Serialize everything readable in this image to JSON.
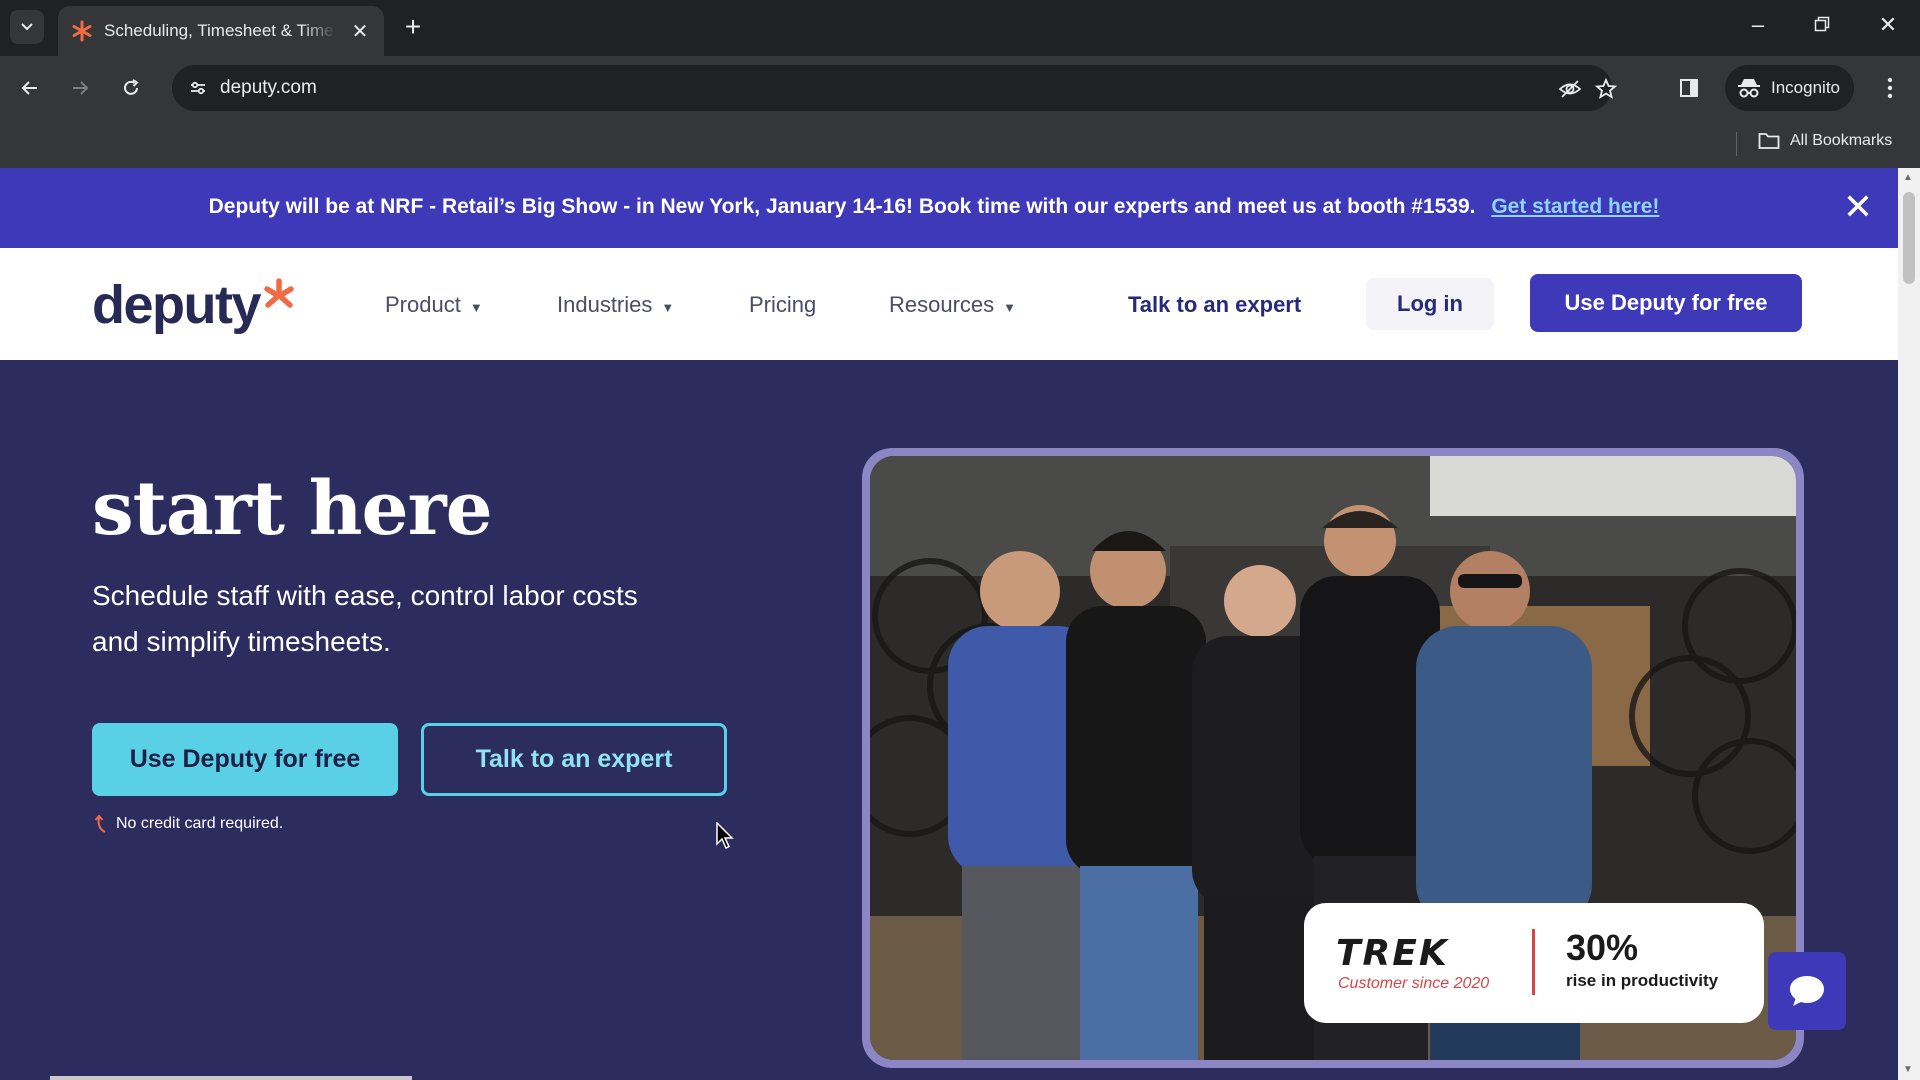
{
  "browser": {
    "tab_title": "Scheduling, Timesheet & Time Clock",
    "url": "deputy.com",
    "incognito_label": "Incognito",
    "bookmarks_label": "All Bookmarks",
    "new_tab": "+",
    "close_tab": "✕"
  },
  "banner": {
    "text": "Deputy will be at NRF - Retail’s Big Show - in New York, January 14-16! Book time with our experts and meet us at booth #1539.",
    "link": "Get started here!",
    "close": "✕"
  },
  "header": {
    "logo": "deputy",
    "nav": [
      {
        "label": "Product"
      },
      {
        "label": "Industries"
      },
      {
        "label": "Pricing"
      },
      {
        "label": "Resources"
      }
    ],
    "talk": "Talk to an expert",
    "login": "Log in",
    "cta": "Use Deputy for free"
  },
  "hero": {
    "title": "start here",
    "subtitle": "Schedule staff with ease, control labor costs and simplify timesheets.",
    "cta": "Use Deputy for free",
    "talk": "Talk to an expert",
    "no_card": "No credit card required."
  },
  "stat": {
    "brand": "TREK",
    "since": "Customer since 2020",
    "value": "30%",
    "label": "rise in productivity"
  },
  "colors": {
    "banner": "#3d39b8",
    "hero_bg": "#2c2c5e",
    "accent": "#5ad0e6",
    "brand_orange": "#f06a43"
  }
}
